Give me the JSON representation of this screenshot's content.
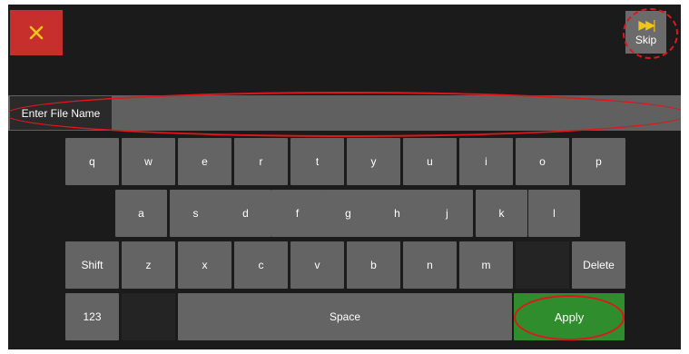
{
  "close": {
    "icon": "close-icon",
    "symbol": "✕"
  },
  "skip": {
    "label": "Skip",
    "icon": "fast-forward-icon"
  },
  "filename": {
    "label": "Enter File Name",
    "value": ""
  },
  "keyboard": {
    "row1": [
      "q",
      "w",
      "e",
      "r",
      "t",
      "y",
      "u",
      "i",
      "o",
      "p"
    ],
    "row2": [
      "a",
      "s",
      "d",
      "f",
      "g",
      "h",
      "j",
      "k",
      "l"
    ],
    "row3": [
      "z",
      "x",
      "c",
      "v",
      "b",
      "n",
      "m"
    ],
    "shift": "Shift",
    "delete": "Delete",
    "numbers": "123",
    "space": "Space",
    "apply": "Apply"
  },
  "colors": {
    "screen_bg": "#1b1b1b",
    "key": "#646464",
    "close": "#c62f2b",
    "apply": "#2f8d2e",
    "annotation": "#e0161b",
    "skip_icon": "#f0c419"
  }
}
